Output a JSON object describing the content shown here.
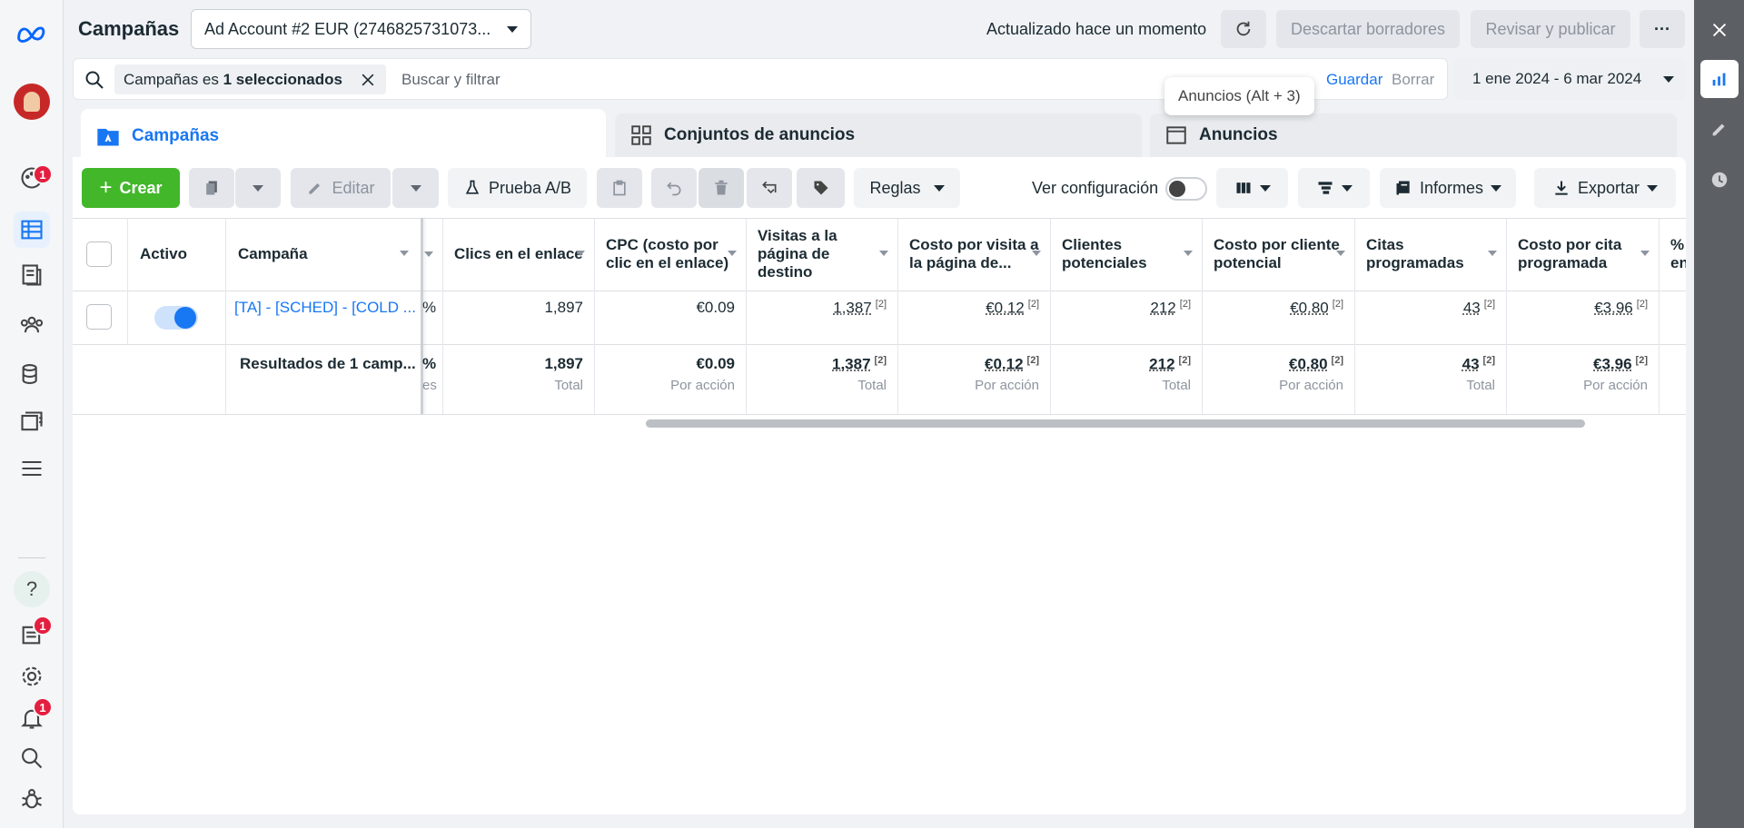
{
  "header": {
    "title": "Campañas",
    "account": "Ad Account #2 EUR (2746825731073...",
    "updated": "Actualizado hace un momento",
    "discard": "Descartar borradores",
    "review": "Revisar y publicar",
    "more": "···"
  },
  "search": {
    "chip_prefix": "Campañas es ",
    "chip_bold": "1 seleccionados",
    "placeholder": "Buscar y filtrar",
    "save": "Guardar",
    "clear": "Borrar",
    "date_range": "1 ene 2024 - 6 mar 2024"
  },
  "tooltip": "Anuncios (Alt + 3)",
  "tabs": [
    {
      "label": "Campañas"
    },
    {
      "label": "Conjuntos de anuncios"
    },
    {
      "label": "Anuncios"
    }
  ],
  "toolbar": {
    "create": "Crear",
    "edit": "Editar",
    "ab_test": "Prueba A/B",
    "rules": "Reglas",
    "view_config": "Ver configuración",
    "reports": "Informes",
    "export": "Exportar"
  },
  "table": {
    "headers": {
      "active": "Activo",
      "campaign": "Campaña",
      "clicks": "Clics en el enlace",
      "cpc": "CPC (costo por clic en el enlace)",
      "visits": "Visitas a la página de destino",
      "cost_visit": "Costo por visita a la página de...",
      "leads": "Clientes potenciales",
      "cost_lead": "Costo por cliente potencial",
      "appointments": "Citas programadas",
      "cost_appt": "Costo por cita programada",
      "pct": "% en"
    },
    "row": {
      "campaign": "[TA] - [SCHED] - [COLD ...",
      "pct": "%",
      "clicks": "1,897",
      "cpc": "€0.09",
      "visits": "1,387",
      "cost_visit": "€0.12",
      "leads": "212",
      "cost_lead": "€0.80",
      "appointments": "43",
      "cost_appt": "€3.96",
      "footnote": "[2]"
    },
    "summary": {
      "label": "Resultados de 1 camp...",
      "pct": "%",
      "pct_sub": "es",
      "clicks": "1,897",
      "cpc": "€0.09",
      "visits": "1,387",
      "cost_visit": "€0.12",
      "leads": "212",
      "cost_lead": "€0.80",
      "appointments": "43",
      "cost_appt": "€3.96",
      "total": "Total",
      "per_action": "Por acción",
      "footnote": "[2]"
    }
  },
  "badges": {
    "notif1": "1",
    "notif2": "1",
    "notif3": "1"
  },
  "colors": {
    "accent": "#1877f2",
    "create_green": "#42b72a",
    "badge_red": "#e41e3f"
  }
}
